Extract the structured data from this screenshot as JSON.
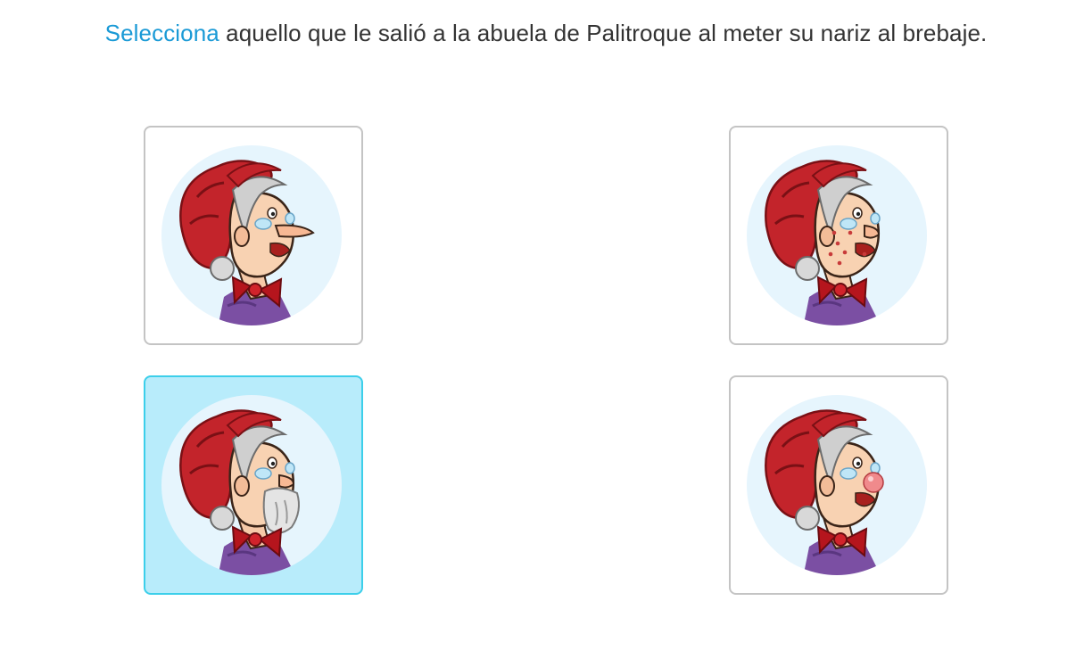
{
  "question": {
    "verb": "Selecciona",
    "text": " aquello que le salió a la abuela de Palitroque al meter su nariz al brebaje."
  },
  "options": [
    {
      "id": 1,
      "variant": "long-nose",
      "selected": false
    },
    {
      "id": 2,
      "variant": "spots",
      "selected": false
    },
    {
      "id": 3,
      "variant": "beard",
      "selected": true
    },
    {
      "id": 4,
      "variant": "red-nose",
      "selected": false
    }
  ],
  "colors": {
    "accent": "#1a9ad6",
    "selected_bg": "#b8ecfb",
    "selected_border": "#3ccfea",
    "card_border": "#c4c4c4",
    "circle_bg": "#e6f5fd",
    "bonnet": "#c3242b",
    "blouse": "#7b4fa3"
  }
}
